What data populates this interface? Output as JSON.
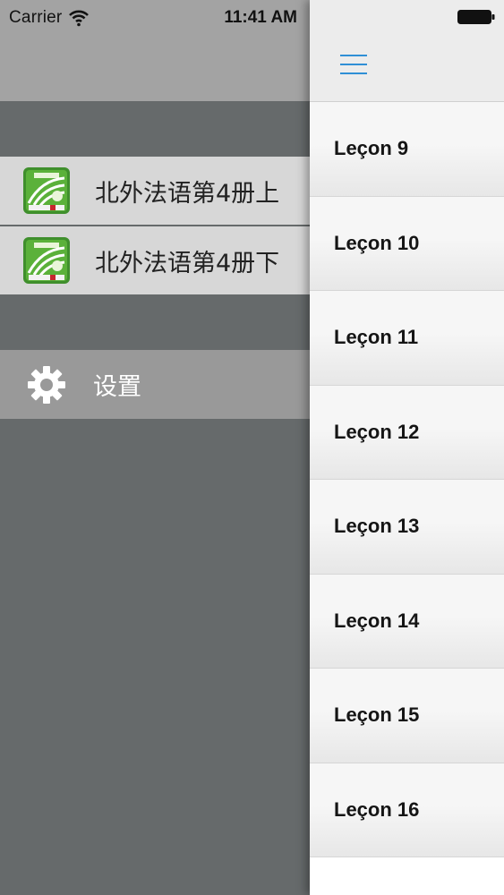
{
  "status_bar": {
    "carrier": "Carrier",
    "time": "11:41 AM"
  },
  "drawer": {
    "books": [
      {
        "label": "北外法语第4册上",
        "icon": "book-cover-icon"
      },
      {
        "label": "北外法语第4册下",
        "icon": "book-cover-icon"
      }
    ],
    "settings": {
      "label": "设置",
      "icon": "gear-icon"
    }
  },
  "main": {
    "menu_icon": "hamburger-menu-icon",
    "lessons": [
      "Leçon 9",
      "Leçon 10",
      "Leçon 11",
      "Leçon 12",
      "Leçon 13",
      "Leçon 14",
      "Leçon 15",
      "Leçon 16"
    ]
  },
  "colors": {
    "accent": "#2f8fd6",
    "drawer_bg": "#666a6b",
    "drawer_header": "#a3a3a3",
    "book_row_bg": "#d7d7d7",
    "settings_row_bg": "#999999"
  }
}
